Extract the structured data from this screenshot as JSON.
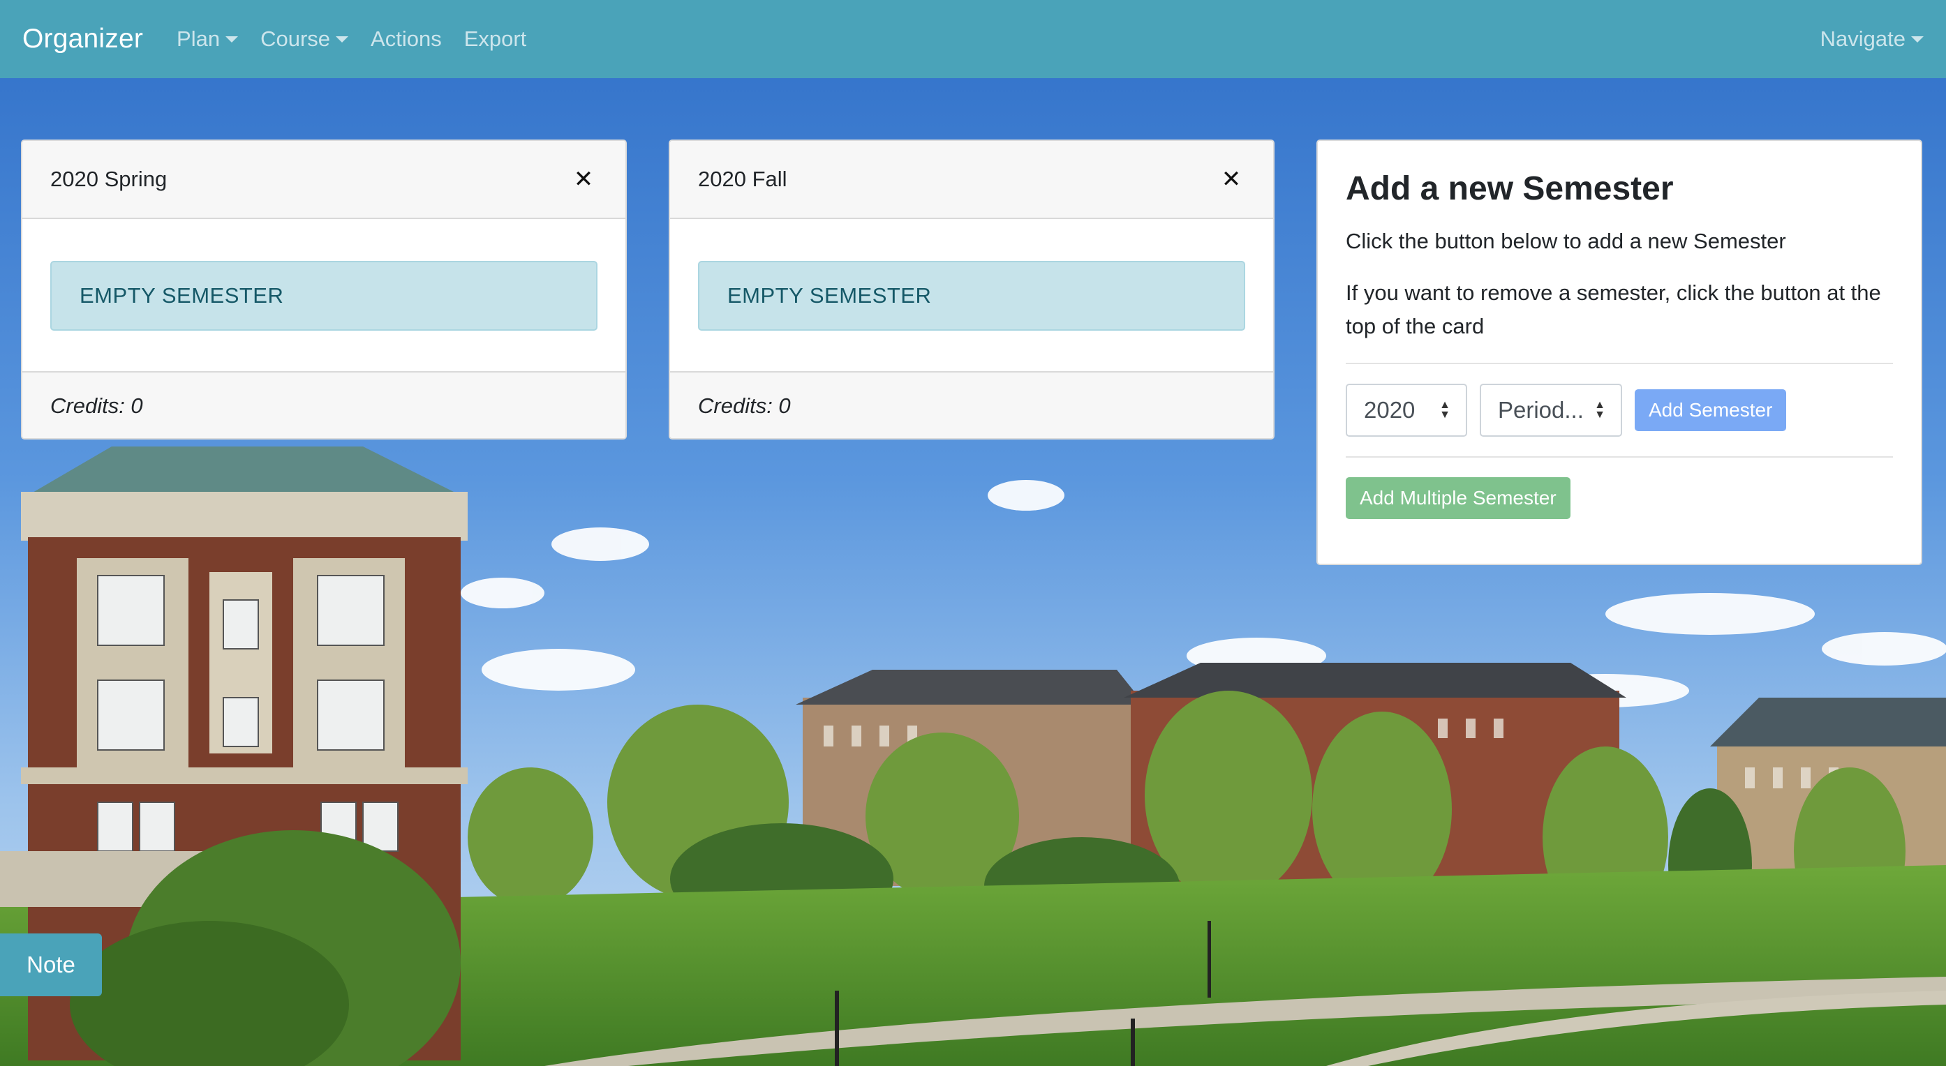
{
  "navbar": {
    "brand": "Organizer",
    "items": [
      {
        "label": "Plan",
        "dropdown": true
      },
      {
        "label": "Course",
        "dropdown": true
      },
      {
        "label": "Actions",
        "dropdown": false
      },
      {
        "label": "Export",
        "dropdown": false
      }
    ],
    "right": {
      "label": "Navigate",
      "dropdown": true
    }
  },
  "semesters": [
    {
      "title": "2020 Spring",
      "empty_label": "EMPTY SEMESTER",
      "credits_label": "Credits: 0",
      "close_icon": "✕"
    },
    {
      "title": "2020 Fall",
      "empty_label": "EMPTY SEMESTER",
      "credits_label": "Credits: 0",
      "close_icon": "✕"
    }
  ],
  "add_panel": {
    "title": "Add a new Semester",
    "text1": "Click the button below to add a new Semester",
    "text2": "If you want to remove a semester, click the button at the top of the card",
    "year_select": {
      "value": "2020"
    },
    "period_select": {
      "value": "Period..."
    },
    "add_button": "Add Semester",
    "add_multiple_button": "Add Multiple Semester"
  },
  "note_button": "Note",
  "colors": {
    "navbar": "#4aa3b9",
    "alert_bg": "#c6e3ea",
    "primary": "#7aa9f5",
    "success": "#7fc28d",
    "sky": "#3f7fcf",
    "grass": "#4f8a2c"
  },
  "icons": {
    "close": "close-icon",
    "caret": "caret-down-icon",
    "select_arrows": "select-updown-icon"
  }
}
